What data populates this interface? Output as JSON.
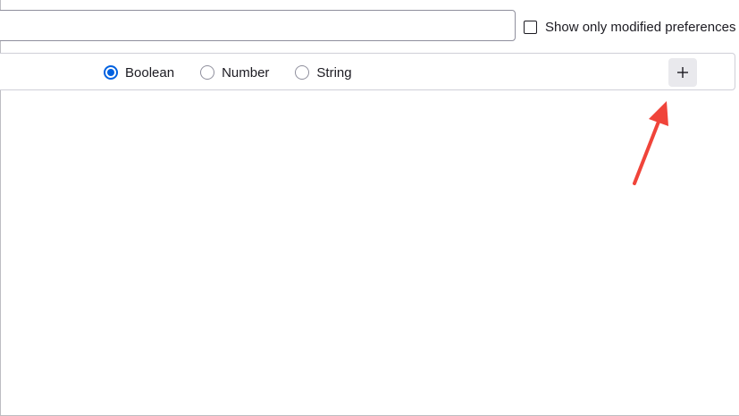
{
  "search": {
    "value": "",
    "placeholder": ""
  },
  "filter": {
    "show_modified_label": "Show only modified preferences",
    "show_modified_checked": false
  },
  "new_pref": {
    "types": [
      {
        "label": "Boolean",
        "checked": true
      },
      {
        "label": "Number",
        "checked": false
      },
      {
        "label": "String",
        "checked": false
      }
    ],
    "add_icon": "plus-icon"
  },
  "colors": {
    "accent": "#0061e0",
    "annotation_arrow": "#f0443a",
    "button_bg": "#e9e9ed"
  },
  "annotation": {
    "icon": "red-arrow-pointing-to-add-button"
  }
}
